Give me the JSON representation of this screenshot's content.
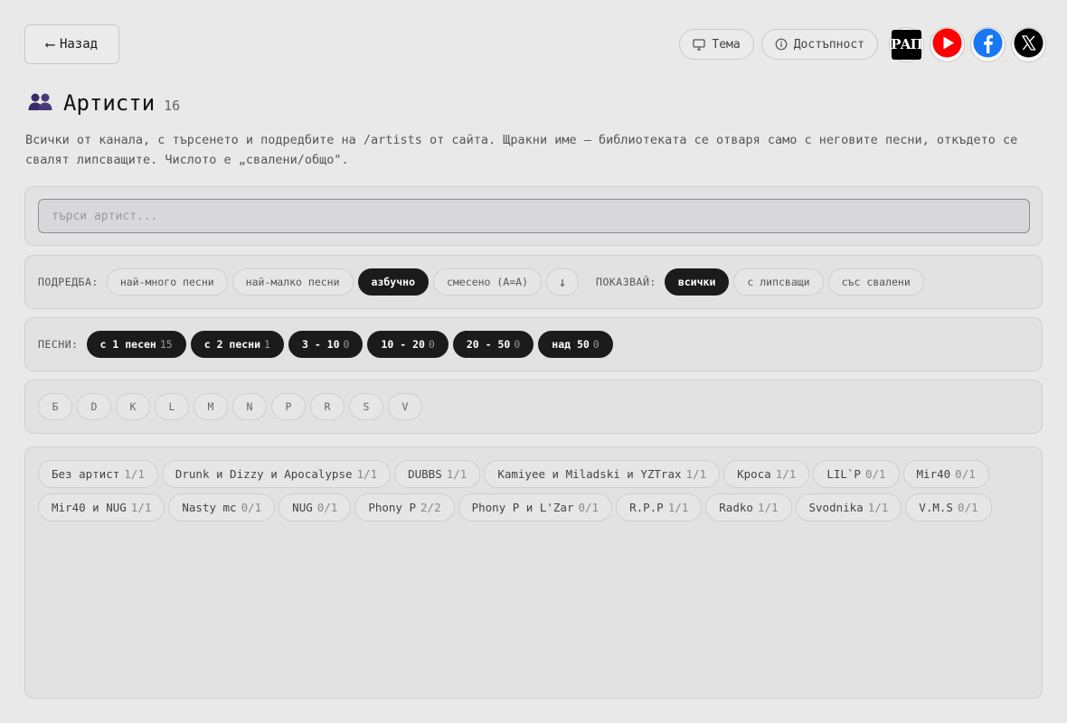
{
  "header": {
    "back_label": "Назад",
    "theme_label": "Тема",
    "accessibility_label": "Достъпност",
    "social": {
      "rap_logo_text": "РАП",
      "youtube_color": "#ff0000",
      "facebook_color": "#1877f2",
      "x_color": "#000000"
    }
  },
  "page": {
    "title": "Артисти",
    "count": "16",
    "description": "Всички от канала, с търсенето и подредбите на /artists от сайта. Щракни име — библиотеката се отваря само с неговите песни, откъдето се свалят липсващите. Числото е „свалени/общо\".",
    "icon": "people-icon",
    "icon_color": "#3b2a63"
  },
  "search": {
    "placeholder": "търси артист..."
  },
  "sort": {
    "label": "ПОДРЕДБА:",
    "options": [
      {
        "label": "най-много песни",
        "active": false
      },
      {
        "label": "най-малко песни",
        "active": false
      },
      {
        "label": "азбучно",
        "active": true
      },
      {
        "label": "смесено (А=А)",
        "active": false
      }
    ],
    "direction_symbol": "↓"
  },
  "show": {
    "label": "ПОКАЗВАЙ:",
    "options": [
      {
        "label": "всички",
        "active": true
      },
      {
        "label": "с липсващи",
        "active": false
      },
      {
        "label": "със свалени",
        "active": false
      }
    ]
  },
  "songs": {
    "label": "ПЕСНИ:",
    "options": [
      {
        "label": "с 1 песен",
        "count": "15"
      },
      {
        "label": "с 2 песни",
        "count": "1"
      },
      {
        "label": "3 - 10",
        "count": "0"
      },
      {
        "label": "10 - 20",
        "count": "0"
      },
      {
        "label": "20 - 50",
        "count": "0"
      },
      {
        "label": "над 50",
        "count": "0"
      }
    ]
  },
  "letters": [
    "Б",
    "D",
    "K",
    "L",
    "M",
    "N",
    "P",
    "R",
    "S",
    "V"
  ],
  "artists": [
    {
      "name": "Без артист",
      "count": "1/1"
    },
    {
      "name": "Drunk и Dizzy и Apocalypse",
      "count": "1/1"
    },
    {
      "name": "DUBBS",
      "count": "1/1"
    },
    {
      "name": "Kamiyee и Miladski и YZTrax",
      "count": "1/1"
    },
    {
      "name": "Kpoca",
      "count": "1/1"
    },
    {
      "name": "LIL`P",
      "count": "0/1"
    },
    {
      "name": "Mir40",
      "count": "0/1"
    },
    {
      "name": "Mir40 и NUG",
      "count": "1/1"
    },
    {
      "name": "Nasty mc",
      "count": "0/1"
    },
    {
      "name": "NUG",
      "count": "0/1"
    },
    {
      "name": "Phony P",
      "count": "2/2"
    },
    {
      "name": "Phony P и L'Zar",
      "count": "0/1"
    },
    {
      "name": "R.P.P",
      "count": "1/1"
    },
    {
      "name": "Radko",
      "count": "1/1"
    },
    {
      "name": "Svodnika",
      "count": "1/1"
    },
    {
      "name": "V.M.S",
      "count": "0/1"
    }
  ]
}
